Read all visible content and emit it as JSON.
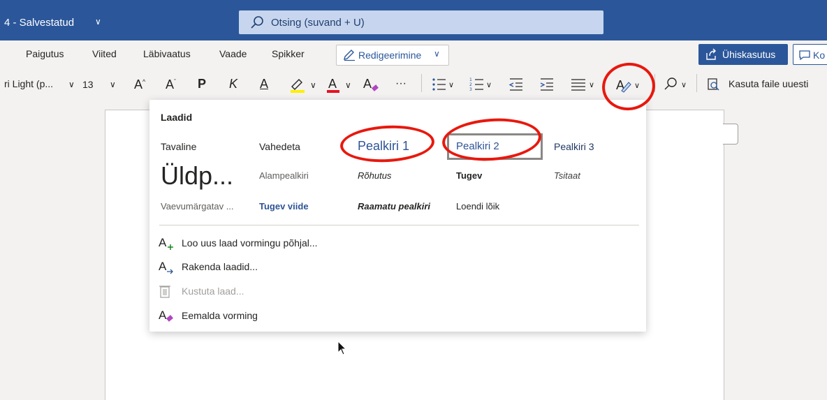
{
  "titlebar": {
    "doc_title": "4 - Salvestatud",
    "search_placeholder": "Otsing (suvand + U)"
  },
  "tabs": [
    "Paigutus",
    "Viited",
    "Läbivaatus",
    "Vaade",
    "Spikker"
  ],
  "edit_mode": "Redigeerimine",
  "share_label": "Ühiskasutus",
  "comment_label": "Ko",
  "toolbar": {
    "font_name": "ri Light (p...",
    "font_size": "13",
    "bold": "P",
    "italic": "K",
    "underline": "A",
    "more": "···",
    "reuse_files": "Kasuta faile uuesti"
  },
  "styles_panel": {
    "heading": "Laadid",
    "styles": [
      "Tavaline",
      "Vahedeta",
      "Pealkiri 1",
      "Pealkiri 2",
      "Pealkiri 3",
      "Üldp...",
      "Alampealkiri",
      "Rõhutus",
      "Tugev",
      "Tsitaat",
      "Vaevumärgatav ...",
      "Tugev viide",
      "Raamatu pealkiri",
      "Loendi lõik"
    ],
    "actions": [
      "Loo uus laad vormingu põhjal...",
      "Rakenda laadid...",
      "Kustuta laad...",
      "Eemalda vorming"
    ]
  },
  "colors": {
    "brand": "#2b579a",
    "heading_blue": "#2f5496",
    "annotation_red": "#e8180e"
  }
}
